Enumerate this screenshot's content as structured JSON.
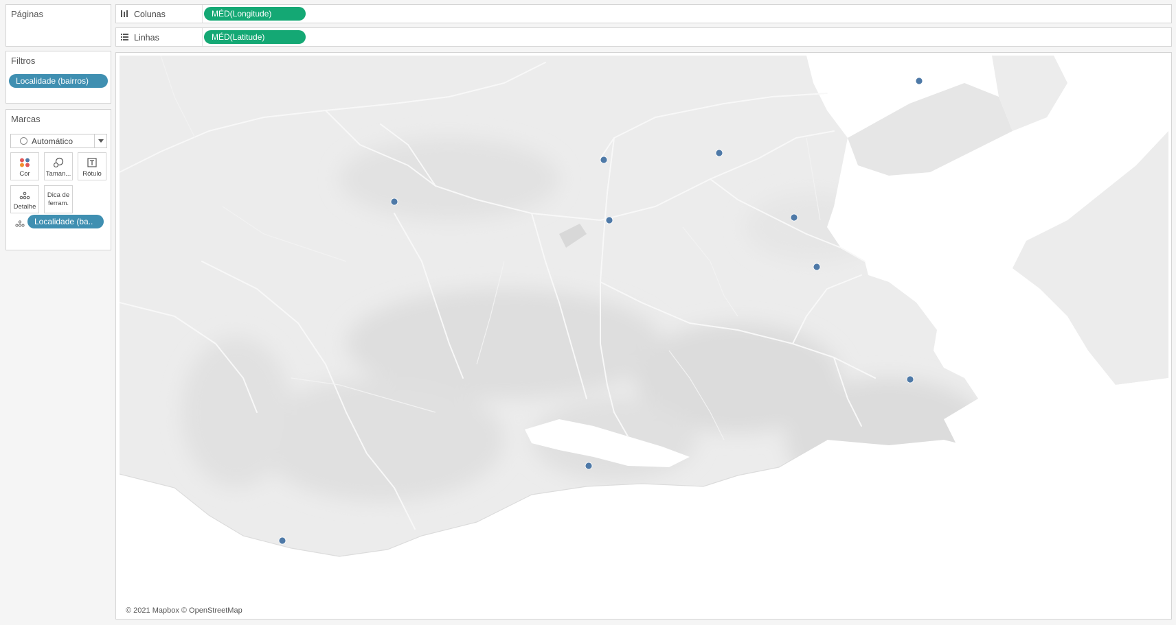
{
  "cards": {
    "pages_title": "Páginas",
    "filters_title": "Filtros",
    "filters": [
      "Localidade (bairros)"
    ],
    "marks_title": "Marcas",
    "mark_type": "Automático",
    "buttons": {
      "color": "Cor",
      "size": "Taman...",
      "label": "Rótulo",
      "detail": "Detalhe",
      "tooltip_line1": "Dica de",
      "tooltip_line2": "ferram."
    },
    "detail_field": "Localidade (ba.."
  },
  "shelves": {
    "columns_label": "Colunas",
    "columns_pill": "MÉD(Longitude)",
    "rows_label": "Linhas",
    "rows_pill": "MÉD(Latitude)"
  },
  "map": {
    "attribution": "© 2021 Mapbox © OpenStreetMap",
    "point_color": "#4e79a7",
    "land_color": "#ececec",
    "water_color": "#ffffff"
  },
  "colors": {
    "pill_dimension": "#3f8fb1",
    "pill_measure": "#14a874"
  }
}
